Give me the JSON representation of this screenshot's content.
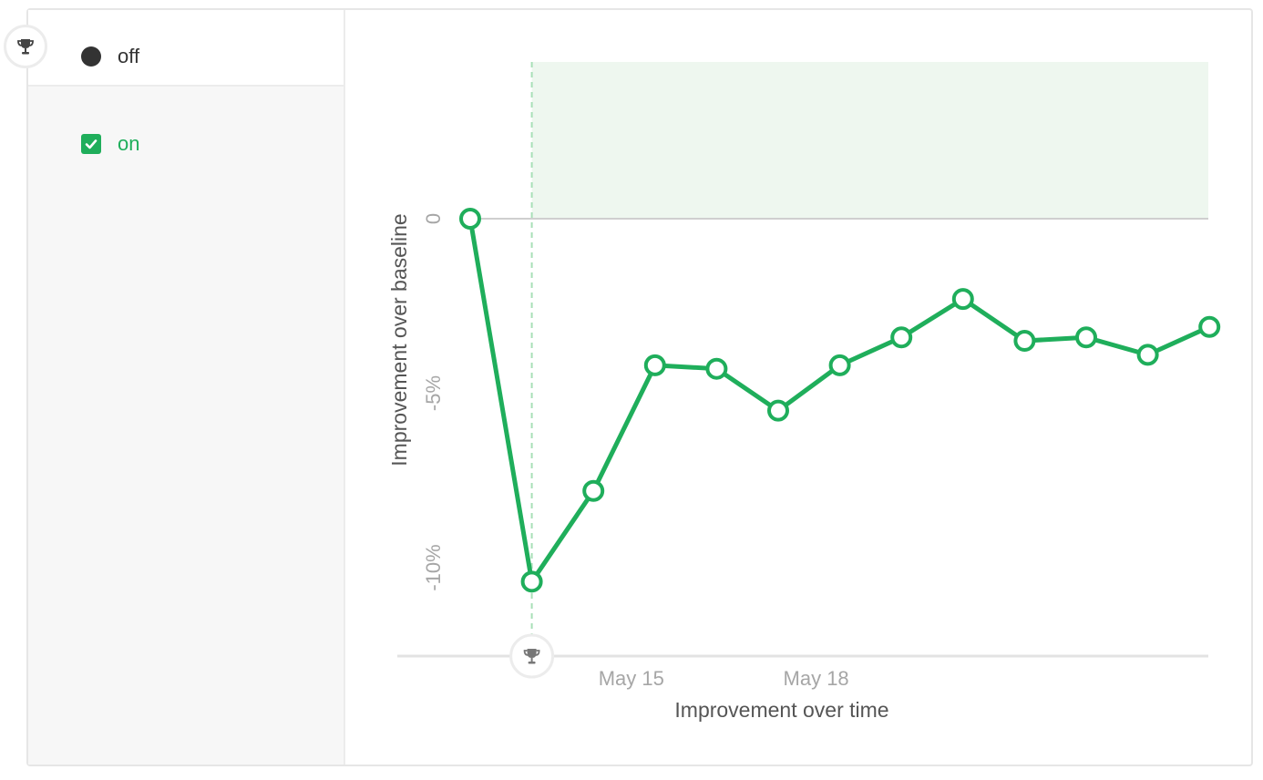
{
  "legend": {
    "off_label": "off",
    "on_label": "on",
    "off_color": "#333333",
    "on_color": "#1fae5b",
    "trophy_icon": "trophy-icon",
    "checkbox_checked": true
  },
  "chart_data": {
    "type": "line",
    "xlabel": "Improvement over time",
    "ylabel": "Improvement over baseline",
    "x_ticks": [
      "May 15",
      "May 18"
    ],
    "y_ticks": [
      "0",
      "-5%",
      "-10%"
    ],
    "ylim": [
      -12.5,
      4.5
    ],
    "grid": false,
    "winner_marker": "trophy",
    "region_color": "#eef7ef",
    "series": [
      {
        "color": "#1fae5b",
        "x": [
          "May 12",
          "May 13",
          "May 14",
          "May 15",
          "May 16",
          "May 17",
          "May 18",
          "May 19",
          "May 20",
          "May 21",
          "May 22",
          "May 23",
          "May 24"
        ],
        "values": [
          0.0,
          -10.4,
          -7.8,
          -4.2,
          -4.3,
          -5.5,
          -4.2,
          -3.4,
          -2.3,
          -3.5,
          -3.4,
          -3.9,
          -3.1
        ]
      }
    ]
  }
}
